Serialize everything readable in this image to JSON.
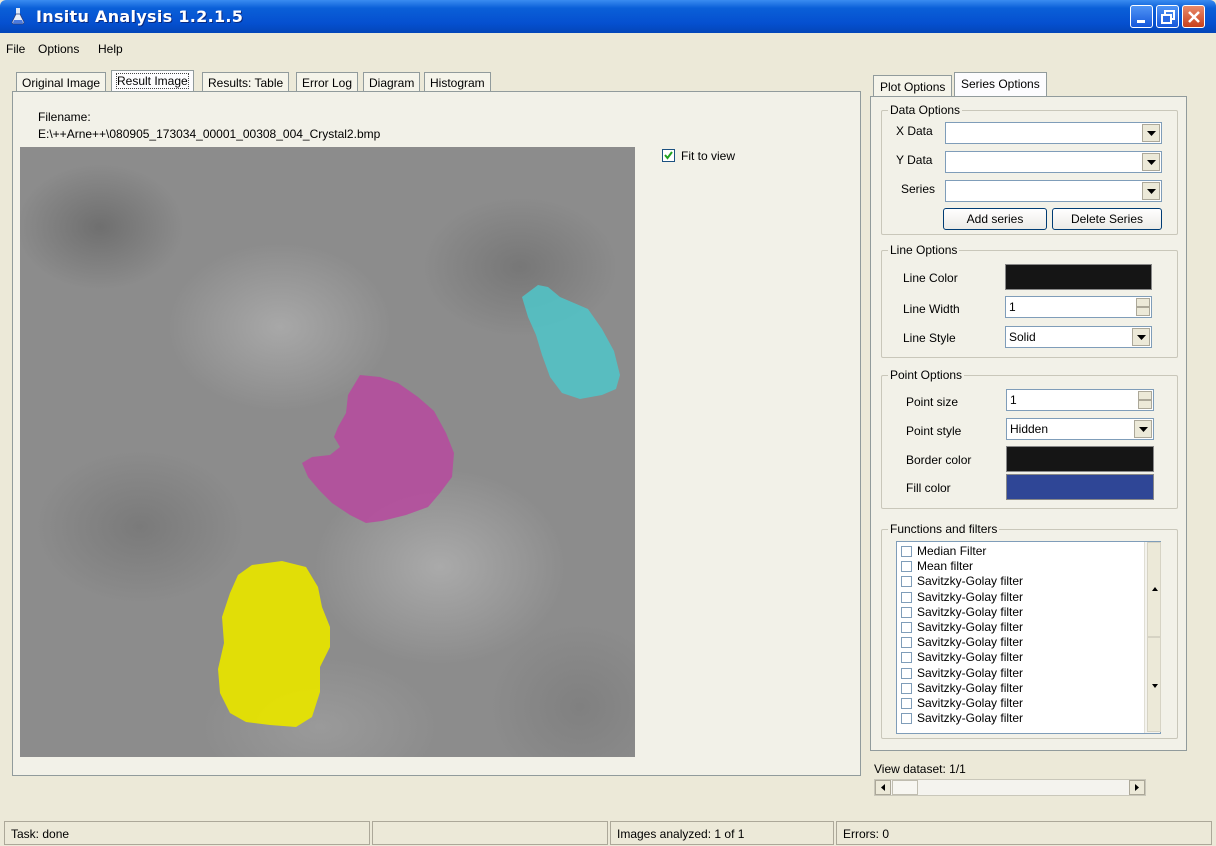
{
  "window": {
    "title": "Insitu Analysis 1.2.1.5"
  },
  "menu": [
    "File",
    "Options",
    "Help"
  ],
  "tabs": [
    "Original Image",
    "Result Image",
    "Results: Table",
    "Error Log",
    "Diagram",
    "Histogram"
  ],
  "active_tab": "Result Image",
  "image_panel": {
    "filename_label": "Filename:",
    "filename": "E:\\++Arne++\\080905_173034_00001_00308_004_Crystal2.bmp",
    "fit_to_view_label": "Fit to view",
    "fit_to_view_checked": true,
    "overlay_colors": {
      "cyan": "#4fc6c9",
      "magenta": "#b54c9d",
      "yellow": "#e6e300"
    }
  },
  "right_tabs": [
    "Plot Options",
    "Series Options"
  ],
  "active_right_tab": "Series Options",
  "data_options": {
    "title": "Data Options",
    "x_label": "X Data",
    "x_value": "",
    "y_label": "Y Data",
    "y_value": "",
    "series_label": "Series",
    "series_value": "",
    "add_button": "Add series",
    "delete_button": "Delete Series"
  },
  "line_options": {
    "title": "Line Options",
    "color_label": "Line Color",
    "color": "#151515",
    "width_label": "Line Width",
    "width_value": "1",
    "style_label": "Line Style",
    "style_value": "Solid"
  },
  "point_options": {
    "title": "Point Options",
    "size_label": "Point size",
    "size_value": "1",
    "style_label": "Point style",
    "style_value": "Hidden",
    "border_label": "Border color",
    "border_color": "#151515",
    "fill_label": "Fill color",
    "fill_color": "#2f4696"
  },
  "functions": {
    "title": "Functions and filters",
    "items": [
      "Median Filter",
      "Mean filter",
      "Savitzky-Golay filter",
      "Savitzky-Golay filter",
      "Savitzky-Golay filter",
      "Savitzky-Golay filter",
      "Savitzky-Golay filter",
      "Savitzky-Golay filter",
      "Savitzky-Golay filter",
      "Savitzky-Golay filter",
      "Savitzky-Golay filter",
      "Savitzky-Golay filter"
    ]
  },
  "view_dataset": "View dataset: 1/1",
  "status": {
    "task": "Task: done",
    "middle": "",
    "images": "Images analyzed: 1 of 1",
    "errors": "Errors: 0"
  }
}
